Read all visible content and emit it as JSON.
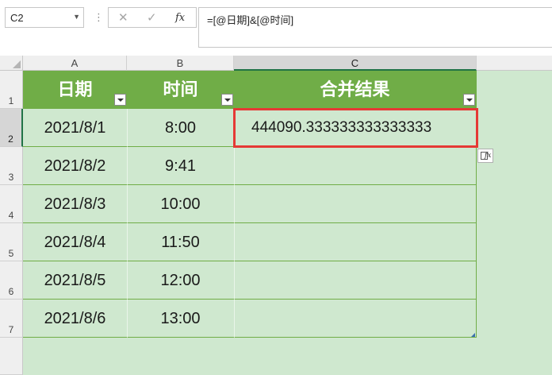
{
  "formula_bar": {
    "name_box": "C2",
    "separator": "⋮",
    "cancel_glyph": "✕",
    "enter_glyph": "✓",
    "fx_glyph": "fx",
    "formula": "=[@日期]&[@时间]"
  },
  "grid": {
    "columns": [
      "A",
      "B",
      "C"
    ],
    "rows": [
      "1",
      "2",
      "3",
      "4",
      "5",
      "6",
      "7"
    ],
    "selected_column": "C",
    "selected_row": "2"
  },
  "table": {
    "headers": [
      "日期",
      "时间",
      "合并结果"
    ],
    "rows": [
      {
        "date": "2021/8/1",
        "time": "8:00",
        "result": "444090.333333333333333"
      },
      {
        "date": "2021/8/2",
        "time": "9:41",
        "result": ""
      },
      {
        "date": "2021/8/3",
        "time": "10:00",
        "result": ""
      },
      {
        "date": "2021/8/4",
        "time": "11:50",
        "result": ""
      },
      {
        "date": "2021/8/5",
        "time": "12:00",
        "result": ""
      },
      {
        "date": "2021/8/6",
        "time": "13:00",
        "result": ""
      }
    ]
  },
  "colors": {
    "table_header": "#70ad47",
    "sheet_fill": "#cfe8cf",
    "active_border": "#e53935",
    "selection_accent": "#217346"
  },
  "icons": {
    "autocorrect_options": "autocorrect-options-icon",
    "filter": "filter-dropdown-icon"
  }
}
